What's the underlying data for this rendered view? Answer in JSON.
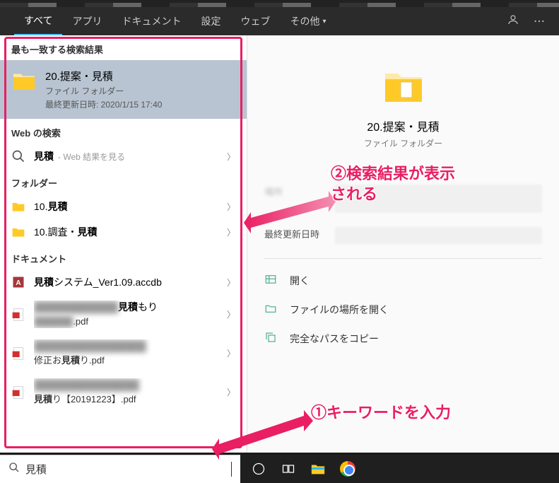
{
  "tabs": {
    "all": "すべて",
    "apps": "アプリ",
    "documents": "ドキュメント",
    "settings": "設定",
    "web": "ウェブ",
    "more": "その他",
    "activeIndex": 0
  },
  "left": {
    "bestMatchHeader": "最も一致する検索結果",
    "bestMatch": {
      "title": "20.提案・見積",
      "type": "ファイル フォルダー",
      "modified": "最終更新日時: 2020/1/15 17:40"
    },
    "webHeader": "Web の検索",
    "webItem": {
      "term": "見積",
      "hint": "- Web 結果を見る"
    },
    "folderHeader": "フォルダー",
    "folders": [
      {
        "bold": "見積",
        "rest": "10."
      },
      {
        "bold": "見積",
        "rest": "10.調査・"
      }
    ],
    "docHeader": "ドキュメント",
    "docs": [
      {
        "line1pre": "",
        "line1bold": "見積",
        "line1post": "システム_Ver1.09.accdb"
      },
      {
        "line1blur": "████████████",
        "line1bold": "見積",
        "line1post": "もり",
        "line2blur": "██████",
        "line2post": ".pdf"
      },
      {
        "line1blur": "████████████████",
        "line2pre": "修正お",
        "line2bold": "見積",
        "line2post": "り.pdf"
      },
      {
        "line1blur": "███████████████",
        "line2bold": "見積",
        "line2post": "り【20191223】.pdf"
      }
    ]
  },
  "right": {
    "title": "20.提案・見積",
    "type": "ファイル フォルダー",
    "metaLocation": "場所",
    "metaModified": "最終更新日時",
    "actions": {
      "open": "開く",
      "openLocation": "ファイルの場所を開く",
      "copyPath": "完全なパスをコピー"
    }
  },
  "annotations": {
    "step1": "①キーワードを入力",
    "step2a": "②検索結果が表示",
    "step2b": "される"
  },
  "search": {
    "value": "見積"
  }
}
